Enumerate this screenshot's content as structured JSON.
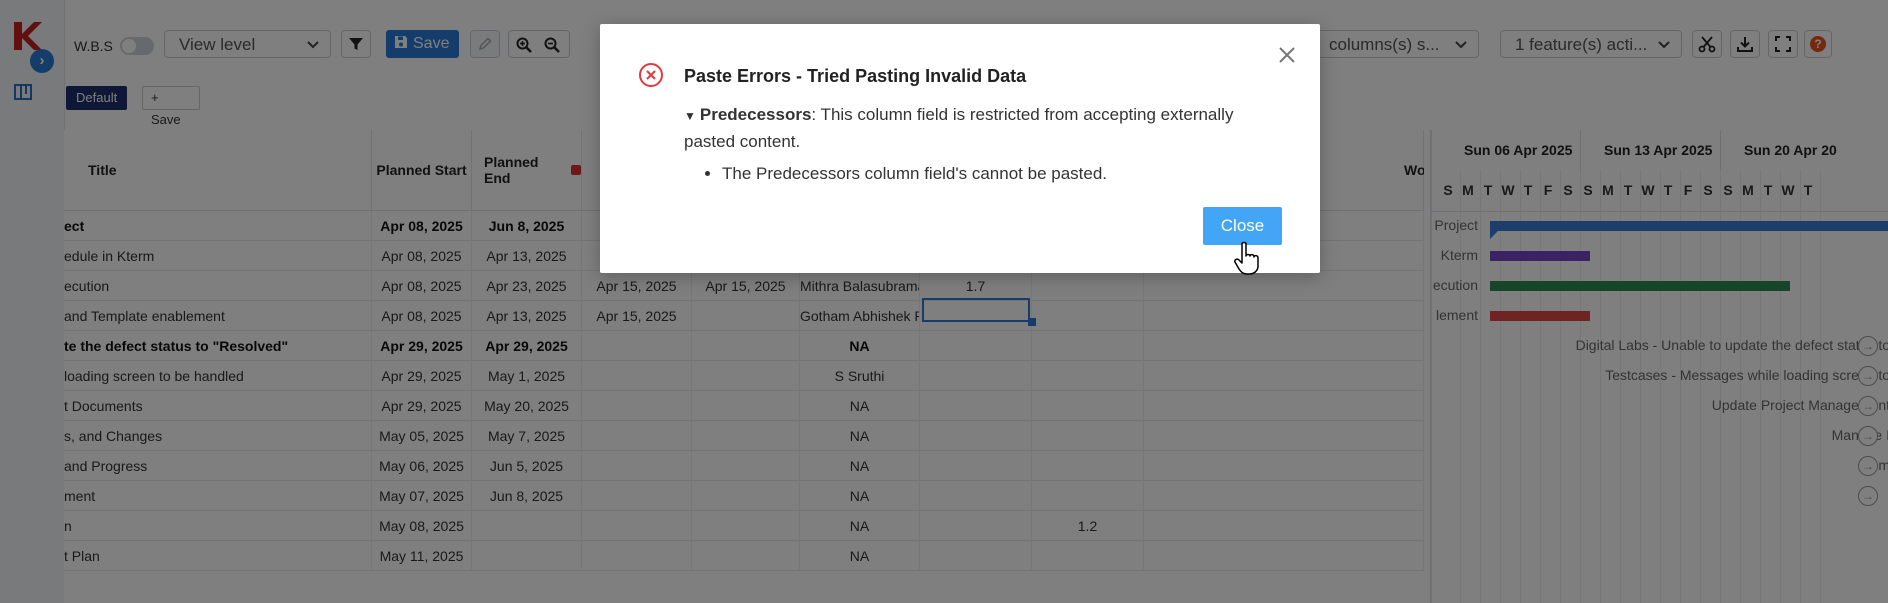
{
  "toolbar": {
    "wbs_label": "W.B.S",
    "view_level": "View level",
    "save_label": "Save",
    "columns_select": "columns(s) s...",
    "feature_select": "1 feature(s) acti..."
  },
  "views": {
    "default_label": "Default",
    "save_view_label": "+ Save current view"
  },
  "columns": {
    "title": "Title",
    "planned_start": "Planned Start",
    "planned_end": "Planned End",
    "workstream": "Workstream"
  },
  "rows": [
    {
      "title": "ect",
      "start": "Apr 08, 2025",
      "end": "Jun 8, 2025",
      "c3": "",
      "c4": "",
      "c5": "",
      "c6": "",
      "c7": "",
      "bold": true
    },
    {
      "title": "edule in Kterm",
      "start": "Apr 08, 2025",
      "end": "Apr 13, 2025",
      "c3": "",
      "c4": "",
      "c5": "",
      "c6": "",
      "c7": ""
    },
    {
      "title": "ecution",
      "start": "Apr 08, 2025",
      "end": "Apr 23, 2025",
      "c3": "Apr 15, 2025",
      "c4": "Apr 15, 2025",
      "c5": "Mithra Balasubramanian",
      "c6": "1.7",
      "c7": ""
    },
    {
      "title": "and Template enablement",
      "start": "Apr 08, 2025",
      "end": "Apr 13, 2025",
      "c3": "Apr 15, 2025",
      "c4": "",
      "c5": "Gotham Abhishek Reddy",
      "c6": "",
      "c7": ""
    },
    {
      "title": "te the defect status to \"Resolved\"",
      "start": "Apr 29, 2025",
      "end": "Apr 29, 2025",
      "c3": "",
      "c4": "",
      "c5": "NA",
      "c6": "",
      "c7": "",
      "bold": true
    },
    {
      "title": " loading screen to be handled",
      "start": "Apr 29, 2025",
      "end": "May 1, 2025",
      "c3": "",
      "c4": "",
      "c5": "S Sruthi",
      "c6": "",
      "c7": ""
    },
    {
      "title": "t Documents",
      "start": "Apr 29, 2025",
      "end": "May 20, 2025",
      "c3": "",
      "c4": "",
      "c5": "NA",
      "c6": "",
      "c7": ""
    },
    {
      "title": "s, and Changes",
      "start": "May 05, 2025",
      "end": "May 7, 2025",
      "c3": "",
      "c4": "",
      "c5": "NA",
      "c6": "",
      "c7": ""
    },
    {
      "title": "and Progress",
      "start": "May 06, 2025",
      "end": "Jun 5, 2025",
      "c3": "",
      "c4": "",
      "c5": "NA",
      "c6": "",
      "c7": ""
    },
    {
      "title": "ment",
      "start": "May 07, 2025",
      "end": "Jun 8, 2025",
      "c3": "",
      "c4": "",
      "c5": "NA",
      "c6": "",
      "c7": ""
    },
    {
      "title": "n",
      "start": "May 08, 2025",
      "end": "",
      "c3": "",
      "c4": "",
      "c5": "NA",
      "c6": "",
      "c7": "1.2"
    },
    {
      "title": "t Plan",
      "start": "May 11, 2025",
      "end": "",
      "c3": "",
      "c4": "",
      "c5": "NA",
      "c6": "",
      "c7": ""
    }
  ],
  "gantt": {
    "weeks": [
      "Sun 06 Apr 2025",
      "Sun 13 Apr 2025",
      "Sun 20 Apr 20"
    ],
    "days": [
      "S",
      "M",
      "T",
      "W",
      "T",
      "F",
      "S",
      "S",
      "M",
      "T",
      "W",
      "T",
      "F",
      "S",
      "S",
      "M",
      "T",
      "W",
      "T"
    ],
    "labels_left": [
      "Project",
      "Kterm",
      "ecution",
      "lement"
    ],
    "labels_right": [
      "Digital Labs - Unable to update the defect status to",
      "Testcases - Messages while loading screen to",
      "Update Project Management",
      "Manage I",
      "Com"
    ],
    "colors": {
      "blue": "#3a7bd5",
      "purple": "#7446c4",
      "green": "#2e8b4e",
      "red": "#e04646"
    }
  },
  "dialog": {
    "title": "Paste Errors - Tried Pasting Invalid Data",
    "field": "Predecessors",
    "message": ": This column field is restricted from accepting externally pasted content.",
    "bullet": "The Predecessors column field's cannot be pasted.",
    "close_label": "Close"
  }
}
